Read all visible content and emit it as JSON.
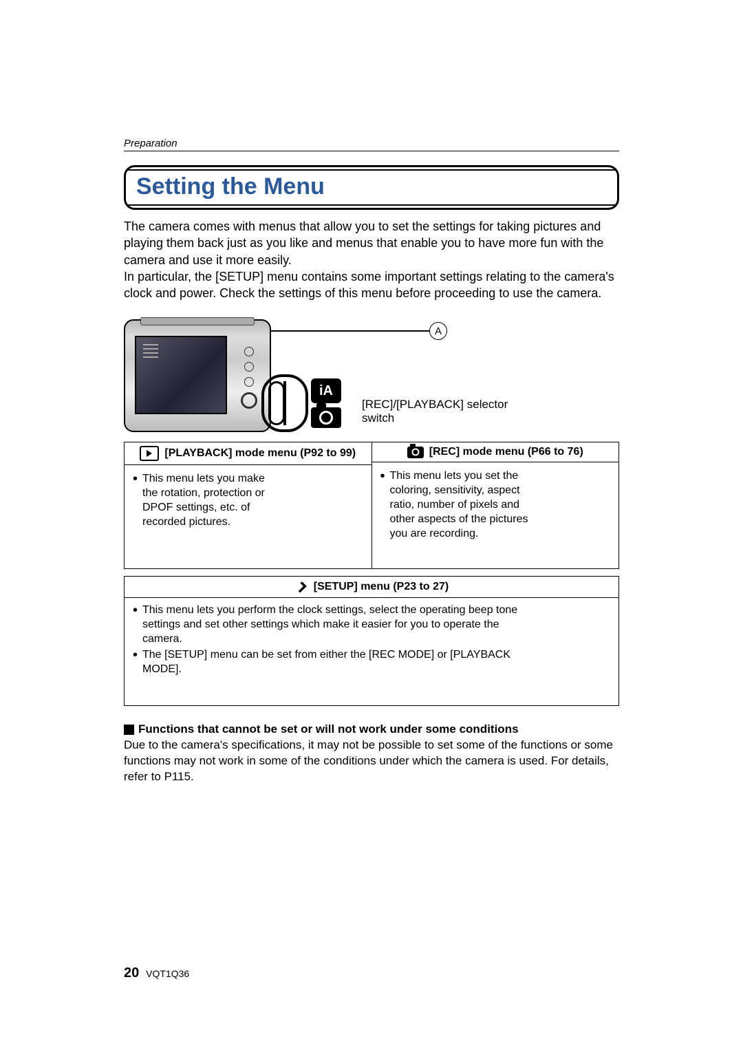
{
  "section": "Preparation",
  "title": "Setting the Menu",
  "intro": "The camera comes with menus that allow you to set the settings for taking pictures and playing them back just as you like and menus that enable you to have more fun with the camera and use it more easily.\nIn particular, the [SETUP] menu contains some important settings relating to the camera's clock and power. Check the settings of this menu before proceeding to use the camera.",
  "callout": "A",
  "ia_label": "iA",
  "selector_note": "[REC]/[PLAYBACK] selector switch",
  "modes": {
    "playback": {
      "header": "[PLAYBACK] mode menu (P92 to 99)",
      "bullet": "This menu lets you make the rotation, protection or DPOF settings, etc. of recorded pictures."
    },
    "rec": {
      "header": "[REC] mode menu (P66 to 76)",
      "bullet": "This menu lets you set the coloring, sensitivity, aspect ratio, number of pixels and other aspects of the pictures you are recording."
    }
  },
  "setup": {
    "header": "[SETUP] menu (P23 to 27)",
    "bullets": [
      "This menu lets you perform the clock settings, select the operating beep tone settings and set other settings which make it easier for you to operate the camera.",
      "The [SETUP] menu can be set from either the [REC MODE] or [PLAYBACK MODE]."
    ]
  },
  "note_head": "Functions that cannot be set or will not work under some conditions",
  "note_body": "Due to the camera's specifications, it may not be possible to set some of the functions or some functions may not work in some of the conditions under which the camera is used. For details, refer to P115.",
  "page_num": "20",
  "doc_code": "VQT1Q36"
}
